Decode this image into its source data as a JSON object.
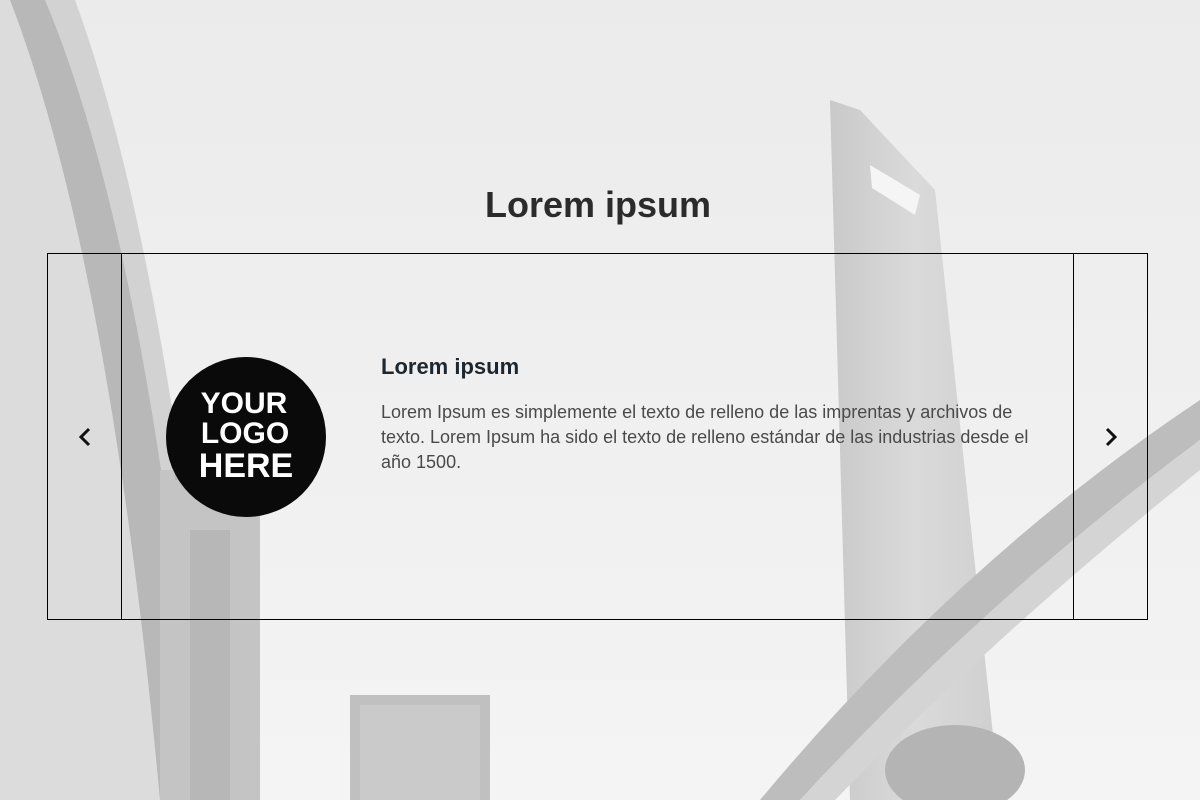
{
  "page": {
    "title": "Lorem ipsum"
  },
  "carousel": {
    "prev_icon": "chevron-left-icon",
    "next_icon": "chevron-right-icon",
    "slide": {
      "logo": {
        "line1": "YOUR",
        "line2": "LOGO",
        "line3": "HERE"
      },
      "title": "Lorem ipsum",
      "text": "Lorem Ipsum es simplemente el texto de relleno de las imprentas y archivos de texto. Lorem Ipsum ha sido el texto de relleno estándar de las industrias desde el año 1500."
    }
  },
  "colors": {
    "background": "#ececec",
    "border": "#000000",
    "heading": "#2b2b2b",
    "body_text": "#4a4a4a"
  }
}
